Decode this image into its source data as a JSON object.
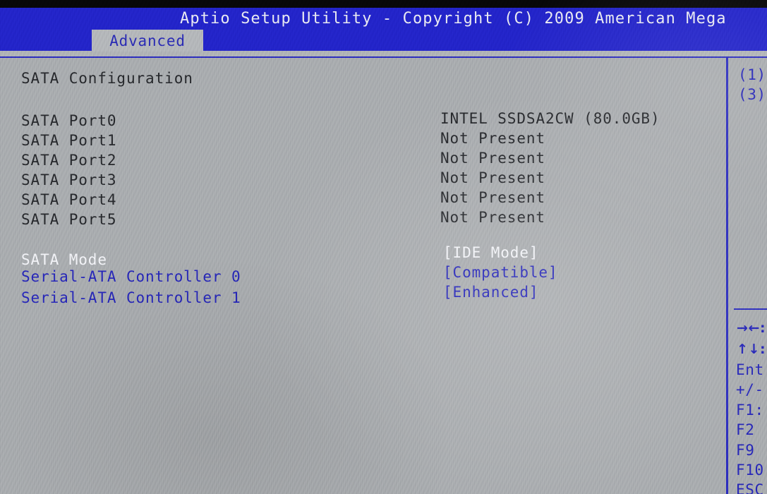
{
  "window": {
    "title": "Aptio Setup Utility - Copyright (C) 2009 American Mega",
    "bezel_color": "#070708",
    "header_bg": "#2324c9",
    "header_fg": "#e9eaf2",
    "body_bg": "#a9acaf",
    "accent_blue": "#2626b8",
    "label_dark": "#26282c",
    "highlight_white": "#f2f3f7"
  },
  "tabs": [
    {
      "label": "Advanced",
      "selected": true
    }
  ],
  "main": {
    "section_title": "SATA Configuration",
    "port_rows": [
      {
        "label": "SATA Port0",
        "value": "INTEL SSDSA2CW (80.0GB)"
      },
      {
        "label": "SATA Port1",
        "value": "Not Present"
      },
      {
        "label": "SATA Port2",
        "value": "Not Present"
      },
      {
        "label": "SATA Port3",
        "value": "Not Present"
      },
      {
        "label": "SATA Port4",
        "value": "Not Present"
      },
      {
        "label": "SATA Port5",
        "value": "Not Present"
      }
    ],
    "setting_rows": [
      {
        "label": "SATA Mode",
        "value": "[IDE Mode]",
        "selected": true
      },
      {
        "label": "Serial-ATA Controller 0",
        "value": "[Compatible]",
        "selected": false
      },
      {
        "label": "Serial-ATA Controller 1",
        "value": "[Enhanced]",
        "selected": false
      }
    ]
  },
  "help_pane": {
    "notes": [
      "(1)",
      "(3)"
    ],
    "keys": [
      "→←:",
      "↑↓:",
      "Ent",
      "+/-",
      "F1:",
      "F2",
      "F9",
      "F10",
      "ESC"
    ]
  }
}
